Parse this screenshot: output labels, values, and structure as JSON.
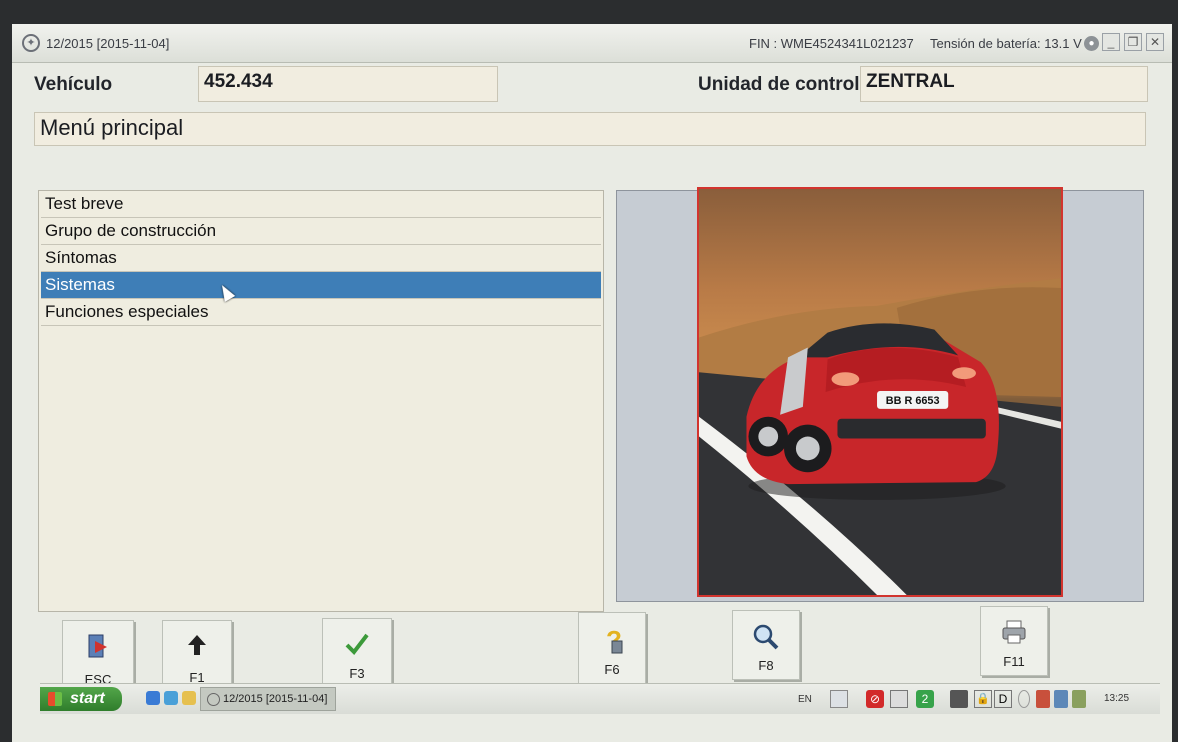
{
  "titlebar": {
    "app_title": "12/2015 [2015-11-04]",
    "fin": "FIN : WME4524341L021237",
    "battery": "Tensión de batería: 13.1 V"
  },
  "header": {
    "vehicle_label": "Vehículo",
    "vehicle_value": "452.434",
    "control_unit_label": "Unidad de control",
    "control_unit_value": "ZENTRAL"
  },
  "menu": {
    "title": "Menú principal",
    "items": [
      {
        "label": "Test breve",
        "selected": false
      },
      {
        "label": "Grupo de construcción",
        "selected": false
      },
      {
        "label": "Síntomas",
        "selected": false
      },
      {
        "label": "Sistemas",
        "selected": true
      },
      {
        "label": "Funciones especiales",
        "selected": false
      }
    ]
  },
  "photo": {
    "plate_text": "BB R 6653"
  },
  "function_keys": [
    {
      "key": "ESC",
      "icon": "exit-door-icon"
    },
    {
      "key": "F1",
      "icon": "arrow-up-icon"
    },
    {
      "key": "F3",
      "icon": "checkmark-icon"
    },
    {
      "key": "F6",
      "icon": "help-question-icon"
    },
    {
      "key": "F8",
      "icon": "magnifier-icon"
    },
    {
      "key": "F11",
      "icon": "printer-icon"
    }
  ],
  "taskbar": {
    "start_label": "start",
    "task_label": "12/2015 [2015-11-04]",
    "language": "EN",
    "tray_letter": "D",
    "clock": "13:25"
  },
  "colors": {
    "selected_row": "#3e7eb7",
    "field_bg": "#f1ede0",
    "photo_border": "#d2342e"
  }
}
